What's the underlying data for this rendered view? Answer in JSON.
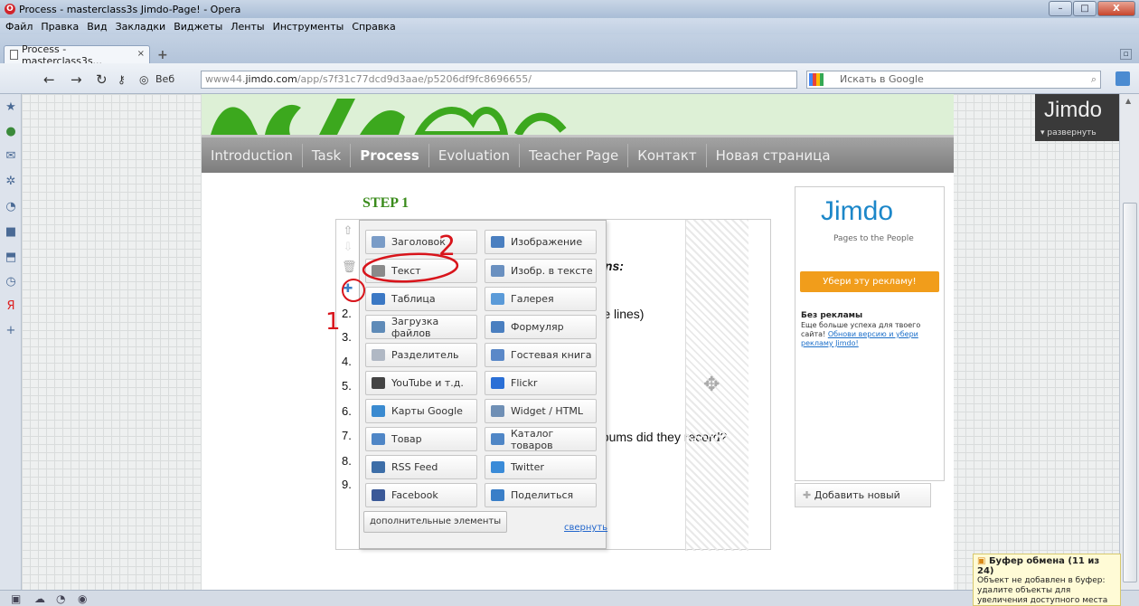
{
  "window": {
    "title": "Process - masterclass3s Jimdo-Page! - Opera",
    "controls": [
      "–",
      "□",
      "X"
    ]
  },
  "menu": [
    "Файл",
    "Правка",
    "Вид",
    "Закладки",
    "Виджеты",
    "Ленты",
    "Инструменты",
    "Справка"
  ],
  "tab": {
    "label": "Process - masterclass3s...",
    "close": "×",
    "new": "+",
    "right_btn": "▫"
  },
  "toolbar": {
    "web_label": "Веб",
    "url_prefix": "www44.",
    "url_domain": "jimdo.com",
    "url_path": "/app/s7f31c77dcd9d3aae/p5206df9fc8696655/",
    "search_placeholder": "Искать в Google"
  },
  "site": {
    "nav": [
      "Introduction",
      "Task",
      "Process",
      "Evoluation",
      "Teacher Page",
      "Контакт",
      "Новая страница"
    ],
    "active_nav": "Process",
    "step_title": "STEP 1",
    "numbers": [
      "2.",
      "3.",
      "4.",
      "5.",
      "6.",
      "7.",
      "8.",
      "9."
    ],
    "text_fragments": {
      "questions": "stions:",
      "five_lines": "(Five lines)",
      "q_mark": "?",
      "albums": "y albums did they record?"
    }
  },
  "popup": {
    "options": [
      {
        "label": "Заголовок",
        "icon": "heading-icon",
        "color": "#7a9cc7"
      },
      {
        "label": "Изображение",
        "icon": "image-icon",
        "color": "#4a7fc0"
      },
      {
        "label": "Текст",
        "icon": "text-icon",
        "color": "#8a8a8a"
      },
      {
        "label": "Изобр. в тексте",
        "icon": "image-in-text-icon",
        "color": "#6a90c0"
      },
      {
        "label": "Таблица",
        "icon": "table-icon",
        "color": "#3b78c4"
      },
      {
        "label": "Галерея",
        "icon": "gallery-icon",
        "color": "#5a9ad8"
      },
      {
        "label": "Загрузка файлов",
        "icon": "upload-icon",
        "color": "#5f8bb8"
      },
      {
        "label": "Формуляр",
        "icon": "form-icon",
        "color": "#4a7fc0"
      },
      {
        "label": "Разделитель",
        "icon": "divider-icon",
        "color": "#b0b8c4"
      },
      {
        "label": "Гостевая книга",
        "icon": "guestbook-icon",
        "color": "#5a88c8"
      },
      {
        "label": "YouTube и т.д.",
        "icon": "youtube-icon",
        "color": "#444444"
      },
      {
        "label": "Flickr",
        "icon": "flickr-icon",
        "color": "#2a6fd6"
      },
      {
        "label": "Карты Google",
        "icon": "map-icon",
        "color": "#3a8ad0"
      },
      {
        "label": "Widget / HTML",
        "icon": "widget-icon",
        "color": "#6f8fb5"
      },
      {
        "label": "Товар",
        "icon": "cart-icon",
        "color": "#4f86c6"
      },
      {
        "label": "Каталог товаров",
        "icon": "catalog-icon",
        "color": "#4f86c6"
      },
      {
        "label": "RSS Feed",
        "icon": "rss-icon",
        "color": "#3d6ea8"
      },
      {
        "label": "Twitter",
        "icon": "twitter-icon",
        "color": "#3a8bd8"
      },
      {
        "label": "Facebook",
        "icon": "facebook-icon",
        "color": "#3b5998"
      },
      {
        "label": "Поделиться",
        "icon": "share-icon",
        "color": "#3a7fc8"
      }
    ],
    "more_label": "дополнительные элементы",
    "collapse_label": "свернуть"
  },
  "annotations": {
    "mark_1": "1",
    "mark_2": "2"
  },
  "ad": {
    "logo": "Jimdo",
    "tagline": "Pages to the People",
    "button": "Убери эту рекламу!",
    "heading": "Без рекламы",
    "body": "Еще больше успеха для твоего сайта!",
    "link": "Обнови версию и убери рекламу Jimdo!"
  },
  "add_new": "Добавить новый",
  "jimdo_corner": {
    "logo": "Jimdo",
    "expand": "развернуть"
  },
  "notice": {
    "title": "Буфер обмена (11 из 24)",
    "body": "Объект не добавлен в буфер: удалите объекты для увеличения доступного места"
  },
  "colors": {
    "accent_green": "#3a8b1b",
    "jimdo_blue": "#1c87c9",
    "ad_orange": "#f19d1b",
    "annotation_red": "#d8141b"
  }
}
